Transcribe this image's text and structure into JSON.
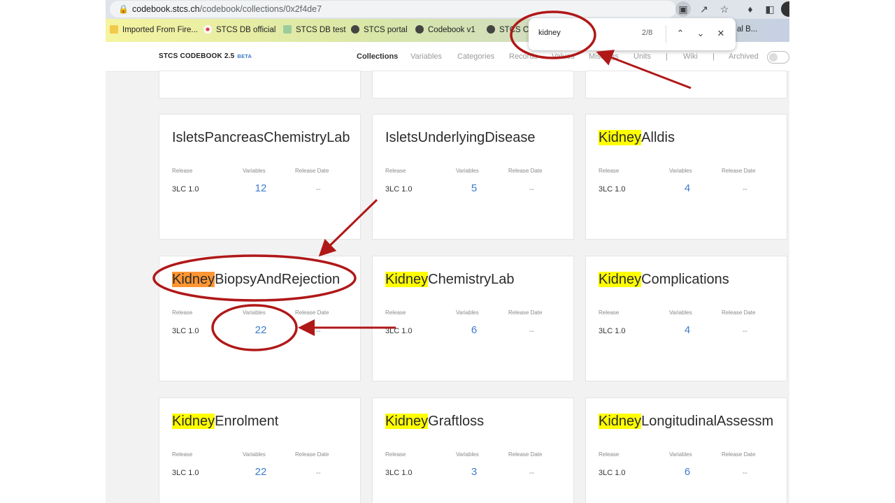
{
  "browser": {
    "url_host": "codebook.stcs.ch",
    "url_path": "/codebook/collections/0x2f4de7",
    "bookmarks": [
      {
        "label": "Imported From Fire...",
        "icon": "folder-icon"
      },
      {
        "label": "STCS DB official",
        "icon": "dots-icon"
      },
      {
        "label": "STCS DB test",
        "icon": "h-icon"
      },
      {
        "label": "STCS portal",
        "icon": "globe-icon"
      },
      {
        "label": "Codebook v1",
        "icon": "globe-icon"
      },
      {
        "label": "STCS Co",
        "icon": "globe-icon"
      },
      {
        "label": "al B...",
        "icon": ""
      }
    ],
    "find": {
      "query": "kidney",
      "count": "2/8"
    }
  },
  "app": {
    "brand": "STCS CODEBOOK 2.5",
    "beta": "BETA",
    "nav": [
      "Collections",
      "Variables",
      "Categories",
      "Records",
      "Values",
      "Missings",
      "Units",
      "|",
      "Wiki",
      "|",
      "Archived"
    ],
    "active_nav": "Collections"
  },
  "labels": {
    "release": "Release",
    "variables": "Variables",
    "release_date": "Release Date"
  },
  "cards": [
    {
      "prefix": "",
      "rest": "IsletsPancreasChemistryLab",
      "release": "3LC 1.0",
      "variables": "12",
      "date": "--"
    },
    {
      "prefix": "",
      "rest": "IsletsUnderlyingDisease",
      "release": "3LC 1.0",
      "variables": "5",
      "date": "--"
    },
    {
      "prefix": "Kidney",
      "rest": "Alldis",
      "release": "3LC 1.0",
      "variables": "4",
      "date": "--"
    },
    {
      "prefix": "Kidney",
      "rest": "BiopsyAndRejection",
      "release": "3LC 1.0",
      "variables": "22",
      "date": "--",
      "current": true
    },
    {
      "prefix": "Kidney",
      "rest": "ChemistryLab",
      "release": "3LC 1.0",
      "variables": "6",
      "date": "--"
    },
    {
      "prefix": "Kidney",
      "rest": "Complications",
      "release": "3LC 1.0",
      "variables": "4",
      "date": "--"
    },
    {
      "prefix": "Kidney",
      "rest": "Enrolment",
      "release": "3LC 1.0",
      "variables": "22",
      "date": "--"
    },
    {
      "prefix": "Kidney",
      "rest": "Graftloss",
      "release": "3LC 1.0",
      "variables": "3",
      "date": "--"
    },
    {
      "prefix": "Kidney",
      "rest": "LongitudinalAssessm",
      "release": "3LC 1.0",
      "variables": "6",
      "date": "--"
    }
  ],
  "colors": {
    "highlight": "#ffff00",
    "current_highlight": "#ff9632",
    "annotation": "#b01818",
    "link": "#3d7cc9"
  }
}
